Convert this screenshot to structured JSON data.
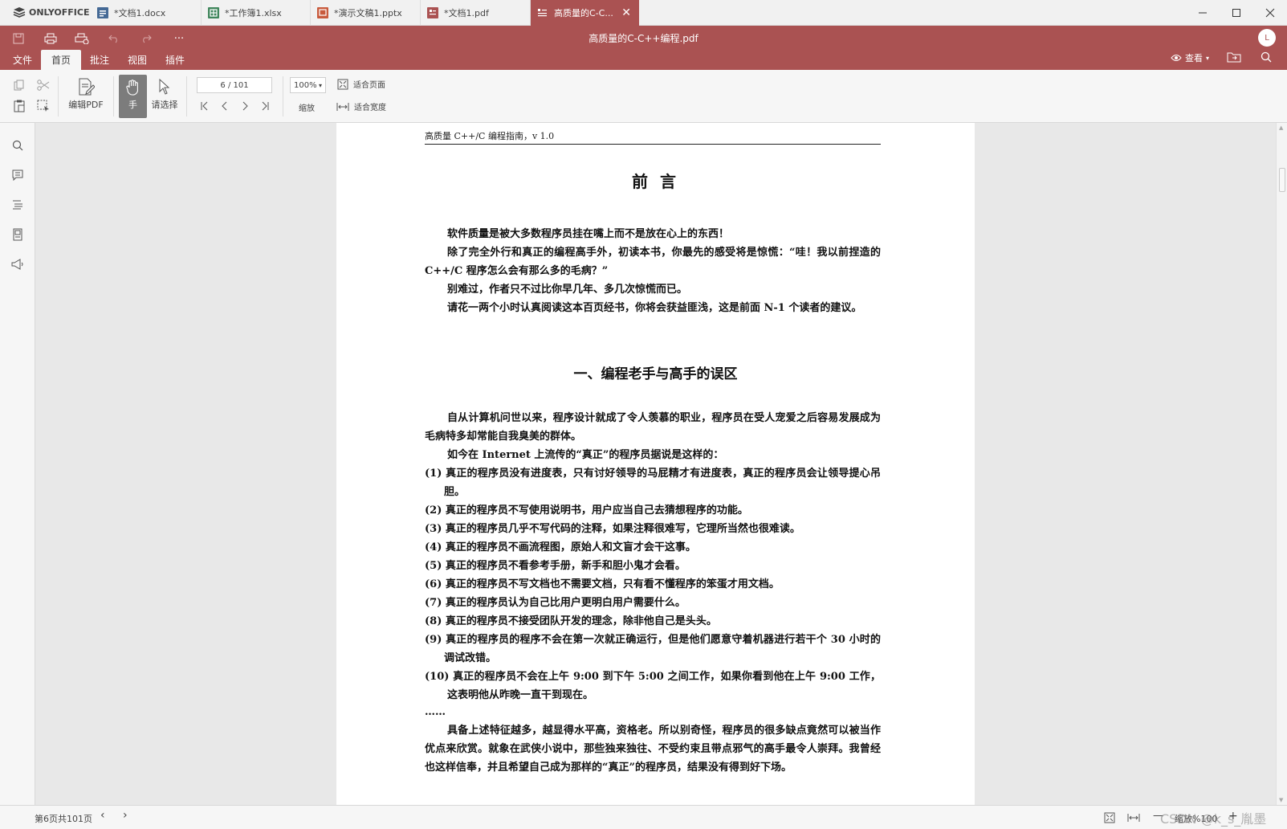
{
  "app": {
    "brand": "ONLYOFFICE",
    "accent": "#aa5252"
  },
  "tabs": [
    {
      "label": "*文档1.docx",
      "icon": "word-doc-icon",
      "color": "#446995"
    },
    {
      "label": "*工作簿1.xlsx",
      "icon": "spreadsheet-icon",
      "color": "#40865c"
    },
    {
      "label": "*演示文稿1.pptx",
      "icon": "presentation-icon",
      "color": "#aa5252"
    },
    {
      "label": "*文档1.pdf",
      "icon": "pdf-icon",
      "color": "#aa5252"
    },
    {
      "label": "高质量的C-C...",
      "icon": "pdf-icon",
      "active": true
    }
  ],
  "header": {
    "title": "高质量的C-C++编程.pdf",
    "avatar": "L",
    "menus": [
      "文件",
      "首页",
      "批注",
      "视图",
      "插件"
    ],
    "active_menu": "首页",
    "view_label": "查看"
  },
  "toolbar": {
    "edit_pdf": "编辑PDF",
    "hand": "手",
    "select": "请选择",
    "page_field": "6 / 101",
    "zoom": "100%",
    "zoom_label": "缩放",
    "fit_page": "适合页面",
    "fit_width": "适合宽度"
  },
  "document": {
    "running_head": "高质量 C++/C 编程指南，v 1.0",
    "preface_title": "前  言",
    "preface_paragraphs": [
      "软件质量是被大多数程序员挂在嘴上而不是放在心上的东西！",
      "除了完全外行和真正的编程高手外，初读本书，你最先的感受将是惊慌：“哇！我以前捏造的 C++/C 程序怎么会有那么多的毛病？”",
      "别难过，作者只不过比你早几年、多几次惊慌而已。",
      "请花一两个小时认真阅读这本百页经书，你将会获益匪浅，这是前面 N-1 个读者的建议。"
    ],
    "section_title": "一、编程老手与高手的误区",
    "intro_paragraphs": [
      "自从计算机问世以来，程序设计就成了令人羡慕的职业，程序员在受人宠爱之后容易发展成为毛病特多却常能自我臭美的群体。",
      "如今在 Internet 上流传的“真正”的程序员据说是这样的："
    ],
    "list_items": [
      "(1) 真正的程序员没有进度表，只有讨好领导的马屁精才有进度表，真正的程序员会让领导提心吊胆。",
      "(2) 真正的程序员不写使用说明书，用户应当自己去猜想程序的功能。",
      "(3) 真正的程序员几乎不写代码的注释，如果注释很难写，它理所当然也很难读。",
      "(4) 真正的程序员不画流程图，原始人和文盲才会干这事。",
      "(5) 真正的程序员不看参考手册，新手和胆小鬼才会看。",
      "(6) 真正的程序员不写文档也不需要文档，只有看不懂程序的笨蛋才用文档。",
      "(7) 真正的程序员认为自己比用户更明白用户需要什么。",
      "(8) 真正的程序员不接受团队开发的理念，除非他自己是头头。",
      "(9) 真正的程序员的程序不会在第一次就正确运行，但是他们愿意守着机器进行若干个 30 小时的调试改错。",
      "(10) 真正的程序员不会在上午 9:00 到下午 5:00 之间工作，如果你看到他在上午 9:00 工作，这表明他从昨晚一直干到现在。"
    ],
    "ellipsis": "……",
    "closing_paragraph": "具备上述特征越多，越显得水平高，资格老。所以别奇怪，程序员的很多缺点竟然可以被当作优点来欣赏。就象在武侠小说中，那些独来独往、不受约束且带点邪气的高手最令人崇拜。我曾经也这样信奉，并且希望自己成为那样的“真正”的程序员，结果没有得到好下场。"
  },
  "statusbar": {
    "page_info": "第6页共101页",
    "zoom_text": "缩放%100",
    "watermark": "CSDN @k_s_胤墨"
  }
}
